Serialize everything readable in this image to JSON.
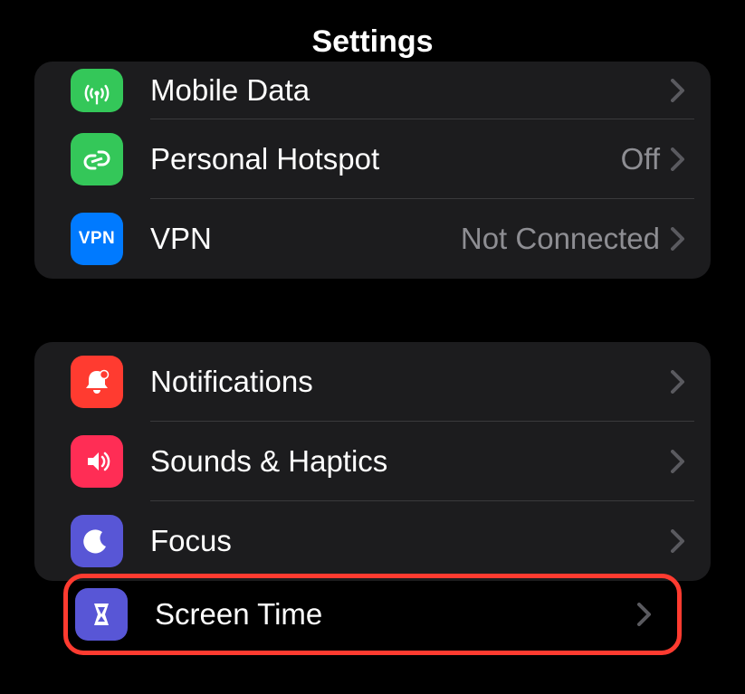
{
  "header": {
    "title": "Settings"
  },
  "group1": {
    "mobile_data": {
      "label": "Mobile Data"
    },
    "personal_hotspot": {
      "label": "Personal Hotspot",
      "value": "Off"
    },
    "vpn": {
      "label": "VPN",
      "value": "Not Connected",
      "icon_text": "VPN"
    }
  },
  "group2": {
    "notifications": {
      "label": "Notifications"
    },
    "sounds_haptics": {
      "label": "Sounds & Haptics"
    },
    "focus": {
      "label": "Focus"
    },
    "screen_time": {
      "label": "Screen Time"
    }
  }
}
